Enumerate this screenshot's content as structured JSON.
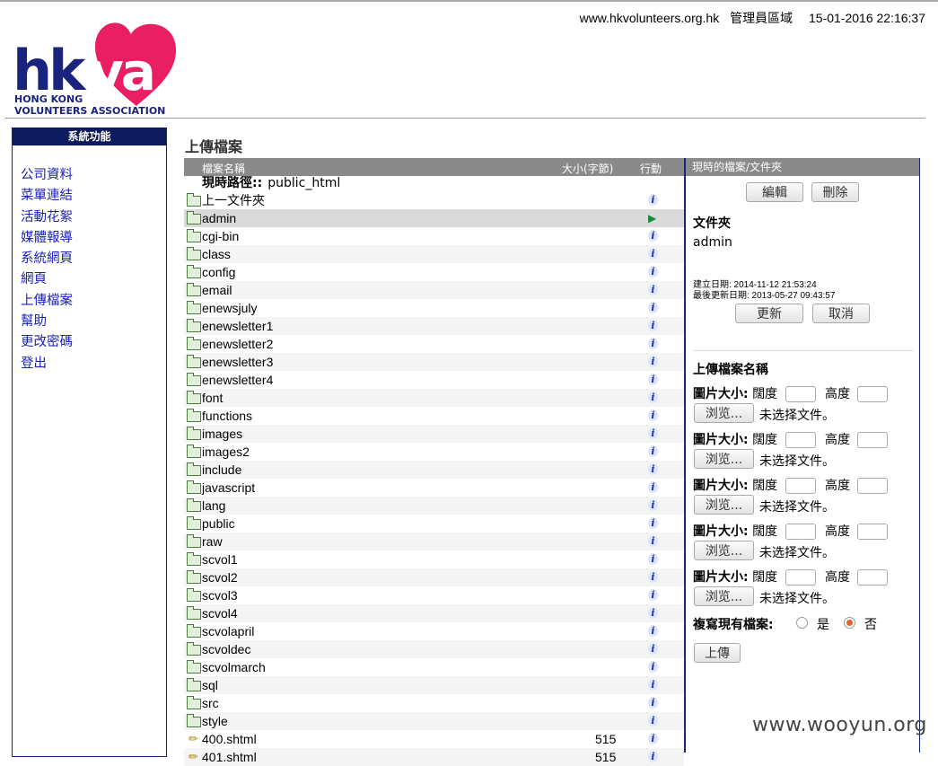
{
  "header": {
    "site": "www.hkvolunteers.org.hk",
    "area": "管理員區域",
    "datetime": "15-01-2016 22:16:37"
  },
  "logo": {
    "text": "hkva",
    "line1": "HONG KONG",
    "line2": "VOLUNTEERS ASSOCIATION",
    "colors": {
      "navy": "#1a237e",
      "pink": "#e91e63"
    }
  },
  "sidebar": {
    "title": "系統功能",
    "items": [
      "公司資料",
      "菜單連結",
      "活動花絮",
      "媒體報導",
      "系統網頁",
      "網頁",
      "上傳檔案",
      "幫助",
      "更改密碼",
      "登出"
    ]
  },
  "page_heading": "上傳檔案",
  "table": {
    "headers": {
      "name": "檔案名稱",
      "size": "大小(字節)",
      "action": "行動"
    },
    "path_label": "現時路徑::",
    "path_value": "public_html",
    "rows": [
      {
        "name": "上一文件夾",
        "type": "folder",
        "size": ""
      },
      {
        "name": "admin",
        "type": "folder",
        "size": "",
        "selected": true
      },
      {
        "name": "cgi-bin",
        "type": "folder",
        "size": ""
      },
      {
        "name": "class",
        "type": "folder",
        "size": ""
      },
      {
        "name": "config",
        "type": "folder",
        "size": ""
      },
      {
        "name": "email",
        "type": "folder",
        "size": ""
      },
      {
        "name": "enewsjuly",
        "type": "folder",
        "size": ""
      },
      {
        "name": "enewsletter1",
        "type": "folder",
        "size": ""
      },
      {
        "name": "enewsletter2",
        "type": "folder",
        "size": ""
      },
      {
        "name": "enewsletter3",
        "type": "folder",
        "size": ""
      },
      {
        "name": "enewsletter4",
        "type": "folder",
        "size": ""
      },
      {
        "name": "font",
        "type": "folder",
        "size": ""
      },
      {
        "name": "functions",
        "type": "folder",
        "size": ""
      },
      {
        "name": "images",
        "type": "folder",
        "size": ""
      },
      {
        "name": "images2",
        "type": "folder",
        "size": ""
      },
      {
        "name": "include",
        "type": "folder",
        "size": ""
      },
      {
        "name": "javascript",
        "type": "folder",
        "size": ""
      },
      {
        "name": "lang",
        "type": "folder",
        "size": ""
      },
      {
        "name": "public",
        "type": "folder",
        "size": ""
      },
      {
        "name": "raw",
        "type": "folder",
        "size": ""
      },
      {
        "name": "scvol1",
        "type": "folder",
        "size": ""
      },
      {
        "name": "scvol2",
        "type": "folder",
        "size": ""
      },
      {
        "name": "scvol3",
        "type": "folder",
        "size": ""
      },
      {
        "name": "scvol4",
        "type": "folder",
        "size": ""
      },
      {
        "name": "scvolapril",
        "type": "folder",
        "size": ""
      },
      {
        "name": "scvoldec",
        "type": "folder",
        "size": ""
      },
      {
        "name": "scvolmarch",
        "type": "folder",
        "size": ""
      },
      {
        "name": "sql",
        "type": "folder",
        "size": ""
      },
      {
        "name": "src",
        "type": "folder",
        "size": ""
      },
      {
        "name": "style",
        "type": "folder",
        "size": ""
      },
      {
        "name": "400.shtml",
        "type": "file",
        "size": "515"
      },
      {
        "name": "401.shtml",
        "type": "file",
        "size": "515"
      }
    ]
  },
  "panel": {
    "title": "現時的檔案/文件夾",
    "edit_label": "編輯",
    "delete_label": "刪除",
    "folder_heading": "文件夾",
    "folder_name": "admin",
    "created": "建立日期:  2014-11-12 21:53:24",
    "modified": "最後更新日期:  2013-05-27 09:43:57",
    "update_label": "更新",
    "cancel_label": "取消",
    "upload_heading": "上傳檔案名稱",
    "img_size_label": "圖片大小:",
    "width_label": "闊度",
    "height_label": "高度",
    "browse_label": "浏览...",
    "no_file_label": "未选择文件。",
    "overwrite_label": "複寫現有檔案:",
    "yes_label": "是",
    "no_label": "否",
    "upload_button": "上傳"
  },
  "watermark": "www.wooyun.org"
}
